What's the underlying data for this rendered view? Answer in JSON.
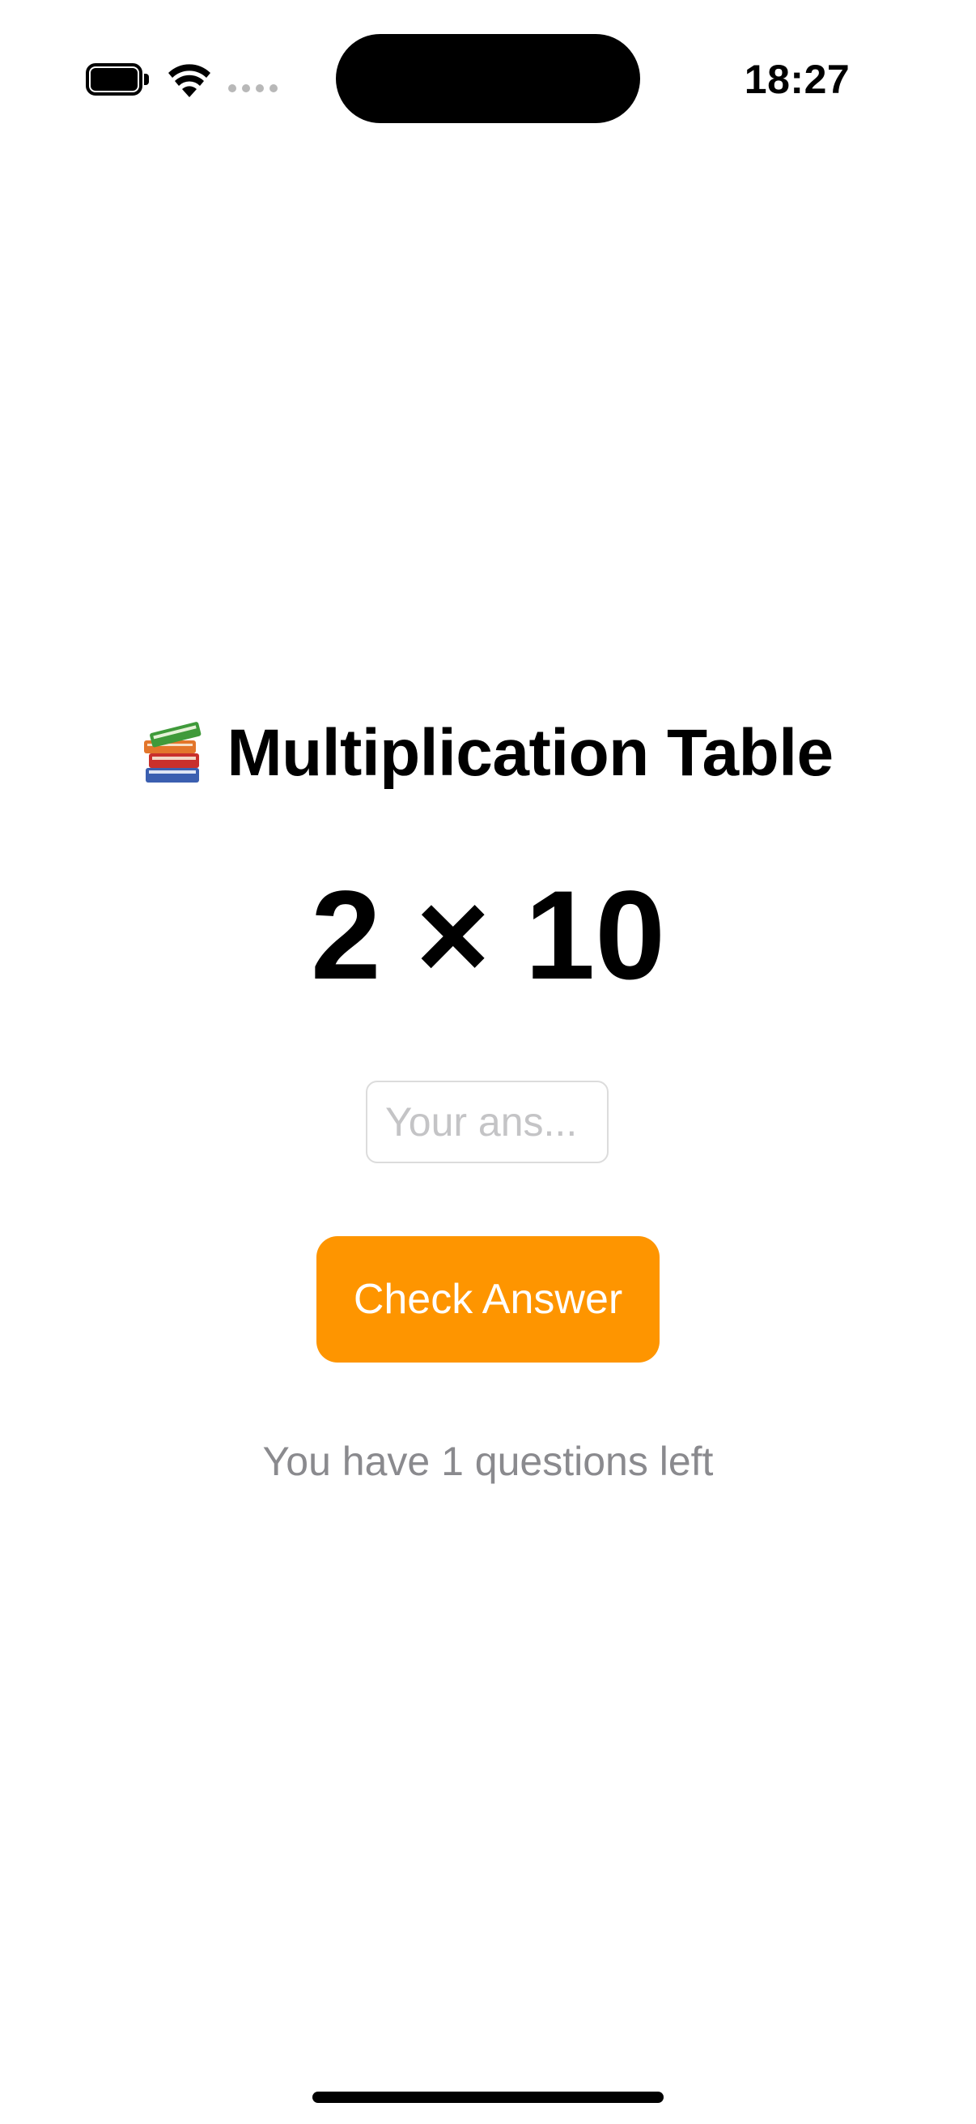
{
  "status_bar": {
    "time": "18:27",
    "icons": [
      "battery-icon",
      "wifi-icon",
      "cellular-signal-icon"
    ]
  },
  "header": {
    "icon": "books-icon",
    "title": "Multiplication Table"
  },
  "question": {
    "text": "2 × 10"
  },
  "answer_input": {
    "value": "",
    "placeholder": "Your ans..."
  },
  "check_button": {
    "label": "Check Answer"
  },
  "status": {
    "questions_left_text": "You have 1 questions left"
  },
  "colors": {
    "accent": "#fe9500",
    "secondary_text": "#8a8a8e",
    "placeholder": "#c4c4c6",
    "input_border": "#dcdcdc"
  }
}
